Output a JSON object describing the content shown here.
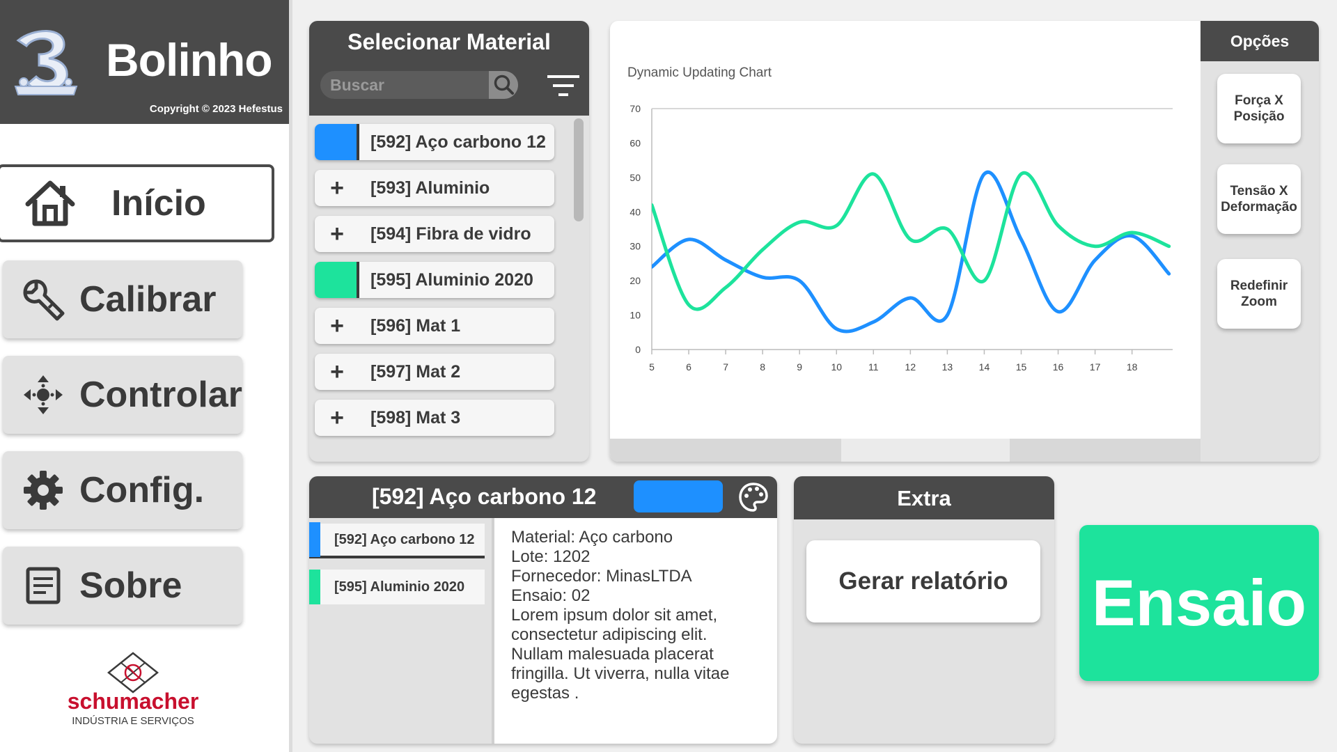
{
  "app": {
    "name": "Bolinho",
    "copyright": "Copyright © 2023 Hefestus"
  },
  "nav": {
    "items": [
      {
        "label": "Início",
        "icon": "home-icon",
        "active": true
      },
      {
        "label": "Calibrar",
        "icon": "wrench-icon",
        "active": false
      },
      {
        "label": "Controlar",
        "icon": "move-arrows-icon",
        "active": false
      },
      {
        "label": "Config.",
        "icon": "gear-icon",
        "active": false
      },
      {
        "label": "Sobre",
        "icon": "document-icon",
        "active": false
      }
    ]
  },
  "company": {
    "name": "schumacher",
    "tagline": "INDÚSTRIA E SERVIÇOS"
  },
  "materials": {
    "title": "Selecionar Material",
    "search_placeholder": "Buscar",
    "items": [
      {
        "label": "[592] Aço carbono 12",
        "selected": true,
        "color": "#1e90ff",
        "marker": ""
      },
      {
        "label": "[593] Aluminio",
        "selected": false,
        "color": "",
        "marker": "+"
      },
      {
        "label": "[594] Fibra de vidro",
        "selected": false,
        "color": "",
        "marker": "+"
      },
      {
        "label": "[595] Aluminio 2020",
        "selected": true,
        "color": "#1de39c",
        "marker": ""
      },
      {
        "label": "[596] Mat 1",
        "selected": false,
        "color": "",
        "marker": "+"
      },
      {
        "label": "[597] Mat 2",
        "selected": false,
        "color": "",
        "marker": "+"
      },
      {
        "label": "[598] Mat 3",
        "selected": false,
        "color": "",
        "marker": "+"
      }
    ]
  },
  "chart_data": {
    "type": "line",
    "title": "Dynamic Updating Chart",
    "xlabel": "",
    "ylabel": "",
    "xlim": [
      5,
      19.1
    ],
    "ylim": [
      0,
      70
    ],
    "xticks": [
      "5",
      "6",
      "7",
      "8",
      "9",
      "10",
      "11",
      "12",
      "13",
      "14",
      "15",
      "16",
      "17",
      "18"
    ],
    "yticks": [
      "0",
      "10",
      "20",
      "30",
      "40",
      "50",
      "60",
      "70"
    ],
    "grid": false,
    "series": [
      {
        "color": "#1e90ff",
        "x": [
          5,
          6,
          7,
          8,
          9,
          10,
          11,
          12,
          13,
          14,
          15,
          16,
          17,
          18,
          19
        ],
        "y": [
          24,
          32,
          26,
          21,
          20,
          6,
          8,
          15,
          10,
          51,
          32,
          11,
          26,
          33,
          22
        ]
      },
      {
        "color": "#1de39c",
        "x": [
          5,
          6,
          7,
          8,
          9,
          10,
          11,
          12,
          13,
          14,
          15,
          16,
          17,
          18,
          19
        ],
        "y": [
          42,
          13,
          18,
          29,
          37,
          36,
          51,
          32,
          35,
          20,
          51,
          36,
          30,
          34,
          30
        ]
      }
    ]
  },
  "options": {
    "title": "Opções",
    "buttons": [
      "Força  X\nPosição",
      "Tensão  X\nDeformação",
      "Redefinir\nZoom"
    ]
  },
  "detail": {
    "title": "[592] Aço carbono 12",
    "color": "#1e90ff",
    "tabs": [
      {
        "label": "[592] Aço carbono 12",
        "color": "#1e90ff",
        "selected": true
      },
      {
        "label": "[595] Aluminio 2020",
        "color": "#1de39c",
        "selected": false
      }
    ],
    "lines": [
      "Material: Aço carbono",
      "Lote: 1202",
      "Fornecedor: MinasLTDA",
      "Ensaio: 02",
      "Lorem ipsum dolor sit amet,",
      "consectetur adipiscing elit.",
      "Nullam malesuada placerat",
      "fringilla. Ut viverra, nulla vitae",
      "egestas ."
    ]
  },
  "extra": {
    "title": "Extra",
    "report_button": "Gerar relatório"
  },
  "ensaio": {
    "label": "Ensaio",
    "color": "#1de39c"
  }
}
